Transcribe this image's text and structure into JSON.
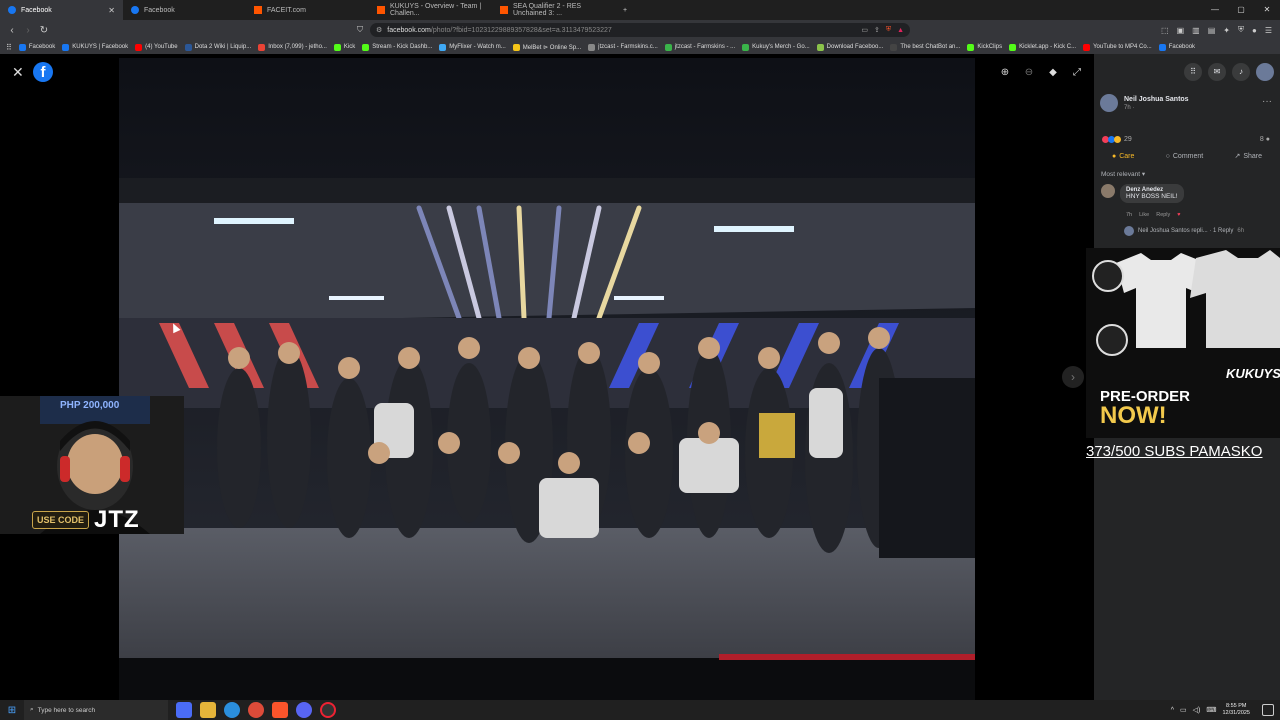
{
  "browser": {
    "tabs": [
      {
        "label": "Facebook",
        "active": true,
        "icon_color": "#1877f2"
      },
      {
        "label": "Facebook",
        "active": false,
        "icon_color": "#1877f2"
      },
      {
        "label": "FACEIT.com",
        "active": false,
        "icon_color": "#ff5500"
      },
      {
        "label": "KUKUYS - Overview - Team | Challen...",
        "active": false,
        "icon_color": "#ff5500"
      },
      {
        "label": "SEA Qualifier 2 - RES Unchained 3: ...",
        "active": false,
        "icon_color": "#ff5500"
      }
    ],
    "url_domain": "facebook.com",
    "url_path": "/photo/?fbid=10231229889357828&set=a.3113479523227",
    "bookmarks": [
      {
        "label": "Facebook",
        "color": "#1877f2"
      },
      {
        "label": "KUKUYS | Facebook",
        "color": "#1877f2"
      },
      {
        "label": "(4) YouTube",
        "color": "#ff0000"
      },
      {
        "label": "Dota 2 Wiki | Liquip...",
        "color": "#2b5797"
      },
      {
        "label": "Inbox (7,099) - jetho...",
        "color": "#ea4335"
      },
      {
        "label": "Kick",
        "color": "#53fc18"
      },
      {
        "label": "Stream - Kick Dashb...",
        "color": "#53fc18"
      },
      {
        "label": "MyFlixer - Watch m...",
        "color": "#3fa9f5"
      },
      {
        "label": "MelBet ⊳ Online Sp...",
        "color": "#f5c518"
      },
      {
        "label": "jtzcast - Farmskins.c...",
        "color": "#888888"
      },
      {
        "label": "jtzcast - Farmskins - ...",
        "color": "#3ab44a"
      },
      {
        "label": "Kukuy's Merch - Go...",
        "color": "#3ab44a"
      },
      {
        "label": "Download Faceboo...",
        "color": "#8bc34a"
      },
      {
        "label": "The best ChatBot an...",
        "color": "#444444"
      },
      {
        "label": "KickClips",
        "color": "#53fc18"
      },
      {
        "label": "Kicklet.app - Kick C...",
        "color": "#53fc18"
      },
      {
        "label": "YouTube to MP4 Co...",
        "color": "#ff0000"
      },
      {
        "label": "Facebook",
        "color": "#1877f2"
      }
    ]
  },
  "post": {
    "author": "Neil Joshua Santos",
    "time": "7h · ",
    "reaction_count": "29",
    "comment_count": "8",
    "actions": {
      "care": "Care",
      "comment": "Comment",
      "share": "Share"
    },
    "sort_label": "Most relevant ▾"
  },
  "comment": {
    "name": "Denz Anedez",
    "text": "HNY BOSS NEIL!",
    "time": "7h",
    "like": "Like",
    "reply": "Reply",
    "replies": "Neil Joshua Santos repli... · 1 Reply",
    "replies_time": "6h"
  },
  "overlay": {
    "ad_headline_1": "PRE-ORDER",
    "ad_headline_2": "NOW!",
    "ad_brand": "KUKUYS",
    "caption": "373/500 SUBS PAMASKO",
    "webcam_banner": "PHP 200,000",
    "code_label": "USE CODE",
    "code_value": "JTZ"
  },
  "taskbar": {
    "search_placeholder": "Type here to search",
    "time": "8:55 PM",
    "date": "12/31/2025"
  },
  "colors": {
    "accent": "#1877f2",
    "care": "#f7b928",
    "love": "#f33e58"
  },
  "icons": [
    "close-icon",
    "zoom-in-icon",
    "zoom-out-icon",
    "tag-icon",
    "fullscreen-icon",
    "menu-grid-icon",
    "messenger-icon",
    "bell-icon",
    "chevron-right-icon"
  ]
}
